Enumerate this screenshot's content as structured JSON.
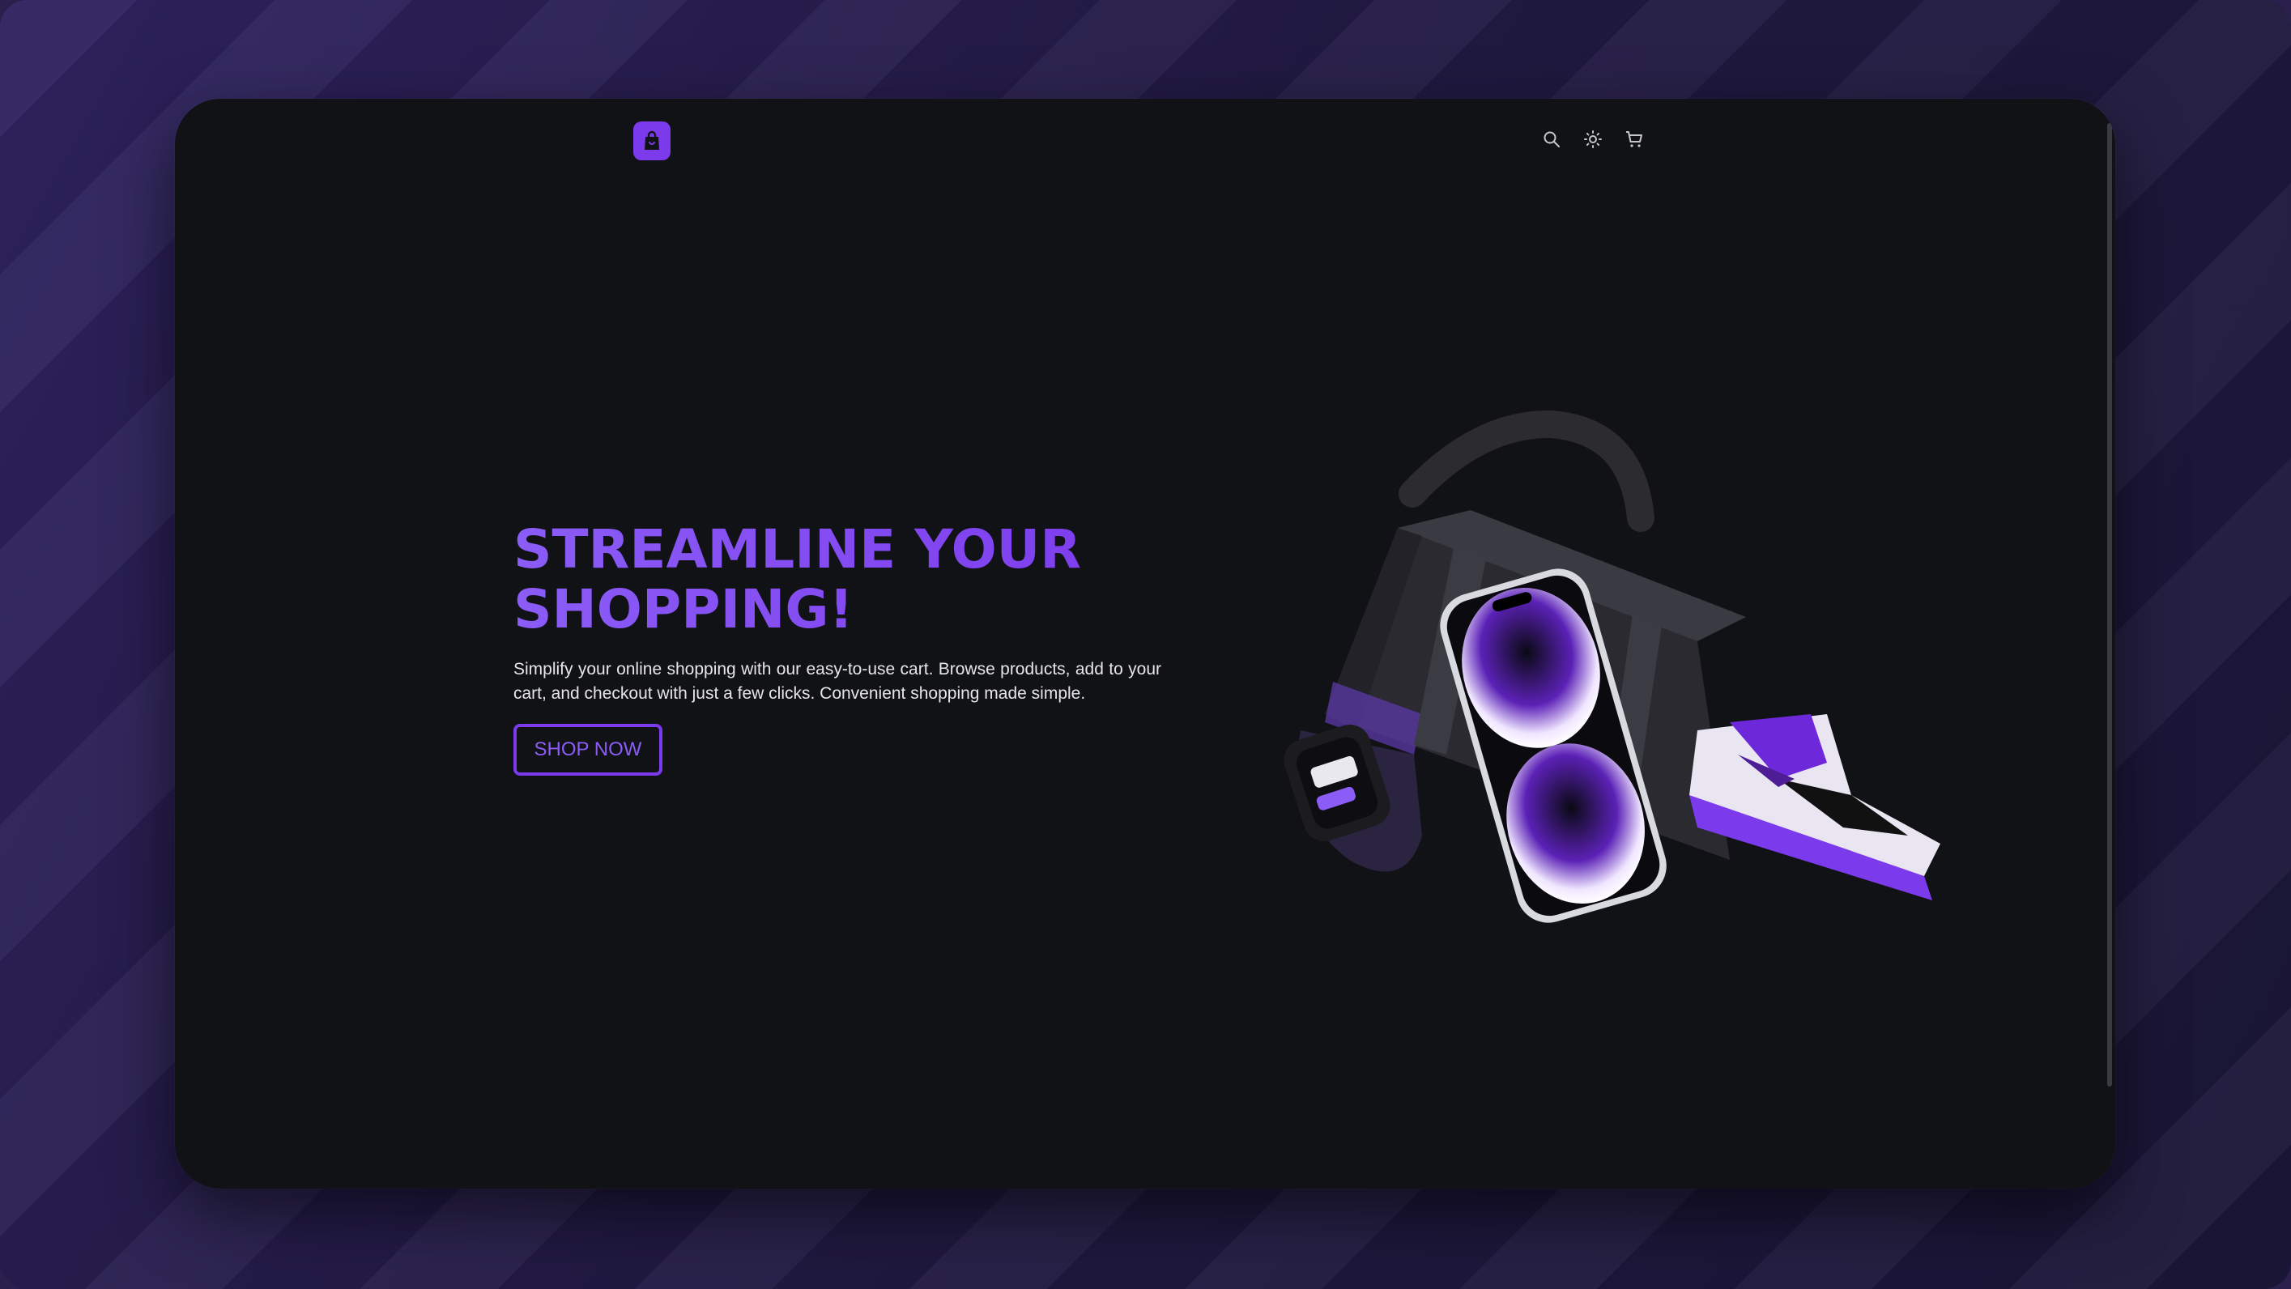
{
  "header": {
    "logo_icon": "shopping-bag-icon",
    "actions": [
      "search-icon",
      "sun-icon",
      "cart-icon"
    ]
  },
  "hero": {
    "title_line1": "STREAMLINE YOUR",
    "title_line2": "SHOPPING!",
    "description": "Simplify your online shopping with our easy-to-use cart. Browse products, add to your cart, and checkout with just a few clicks. Convenient shopping made simple.",
    "cta_label": "SHOP NOW"
  },
  "colors": {
    "accent": "#7c3aed",
    "window_bg": "#111216",
    "backdrop": "#2a1f4d"
  }
}
